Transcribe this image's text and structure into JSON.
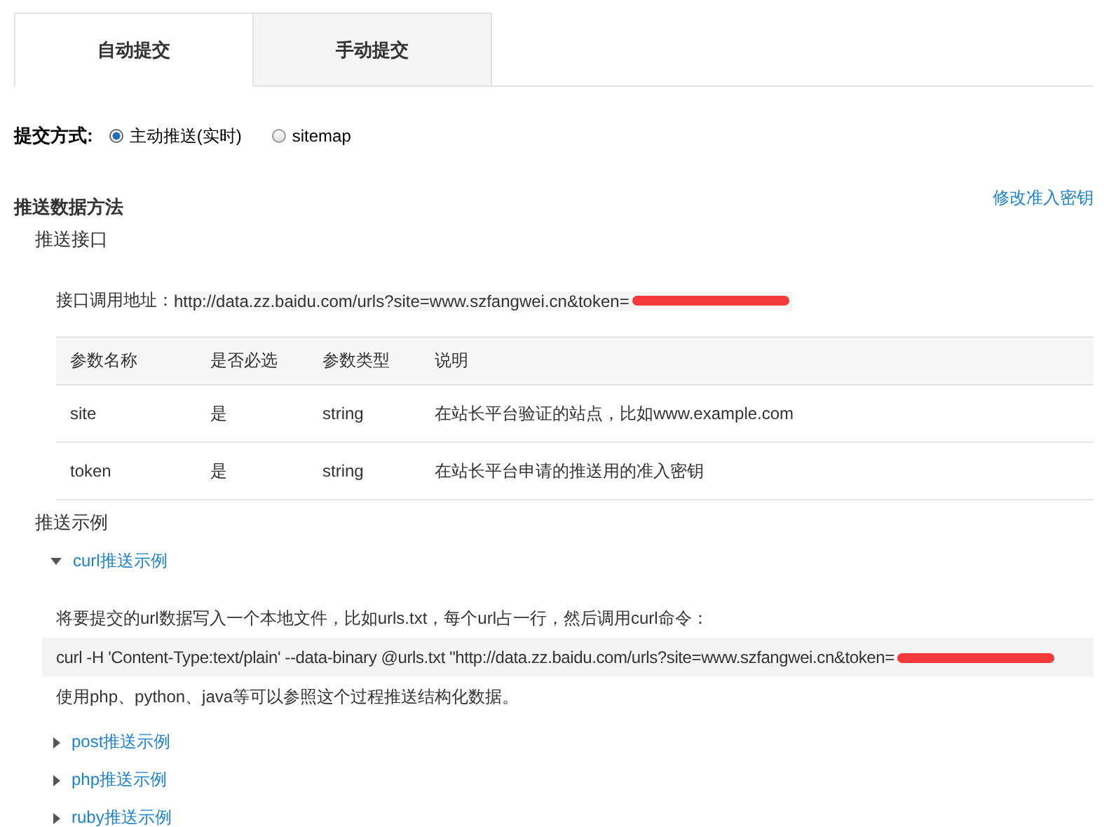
{
  "tabs": [
    {
      "label": "自动提交",
      "selected": true
    },
    {
      "label": "手动提交",
      "selected": false
    }
  ],
  "submit_method": {
    "label": "提交方式:",
    "options": [
      {
        "label": "主动推送(实时)",
        "selected": true
      },
      {
        "label": "sitemap",
        "selected": false
      }
    ]
  },
  "section": {
    "title": "推送数据方法",
    "link": "修改准入密钥"
  },
  "api": {
    "title": "推送接口",
    "address_label": "接口调用地址：",
    "address": "http://data.zz.baidu.com/urls?site=www.szfangwei.cn&token=",
    "redacted": true
  },
  "table": {
    "columns": [
      "参数名称",
      "是否必选",
      "参数类型",
      "说明"
    ],
    "rows": [
      [
        "site",
        "是",
        "string",
        "在站长平台验证的站点，比如www.example.com"
      ],
      [
        "token",
        "是",
        "string",
        "在站长平台申请的推送用的准入密钥"
      ]
    ]
  },
  "examples_title": "推送示例",
  "examples": [
    {
      "label": "curl推送示例",
      "expanded": true,
      "intro": "将要提交的url数据写入一个本地文件，比如urls.txt，每个url占一行，然后调用curl命令：",
      "code": "curl -H 'Content-Type:text/plain' --data-binary @urls.txt \"http://data.zz.baidu.com/urls?site=www.szfangwei.cn&token=",
      "code_redacted": true,
      "note": "使用php、python、java等可以参照这个过程推送结构化数据。"
    },
    {
      "label": "post推送示例",
      "expanded": false
    },
    {
      "label": "php推送示例",
      "expanded": false
    },
    {
      "label": "ruby推送示例",
      "expanded": false
    }
  ]
}
